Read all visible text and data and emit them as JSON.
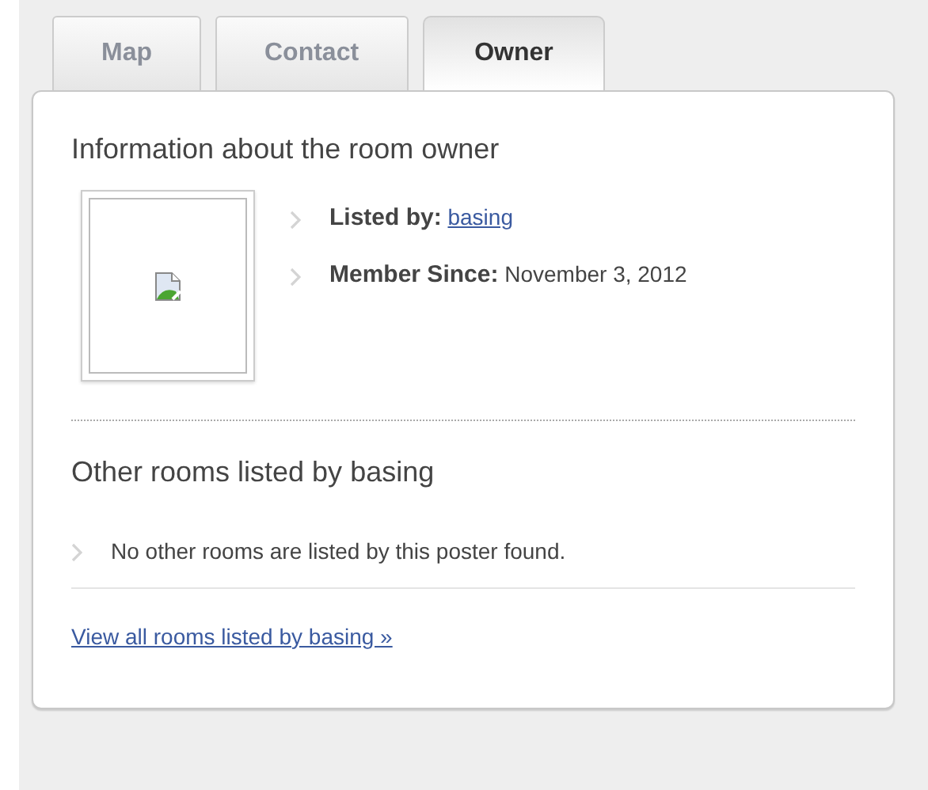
{
  "tabs": [
    {
      "label": "Map",
      "selected": false
    },
    {
      "label": "Contact",
      "selected": false
    },
    {
      "label": "Owner",
      "selected": true
    }
  ],
  "owner": {
    "heading": "Information about the room owner",
    "details": [
      {
        "label": "Listed by:",
        "value": "basing",
        "kind": "link"
      },
      {
        "label": "Member Since:",
        "value": "November 3, 2012",
        "kind": "text"
      }
    ]
  },
  "other_rooms": {
    "heading": "Other rooms listed by basing",
    "items": [
      "No other rooms are listed by this poster found."
    ],
    "link": "View all rooms listed by basing »"
  }
}
